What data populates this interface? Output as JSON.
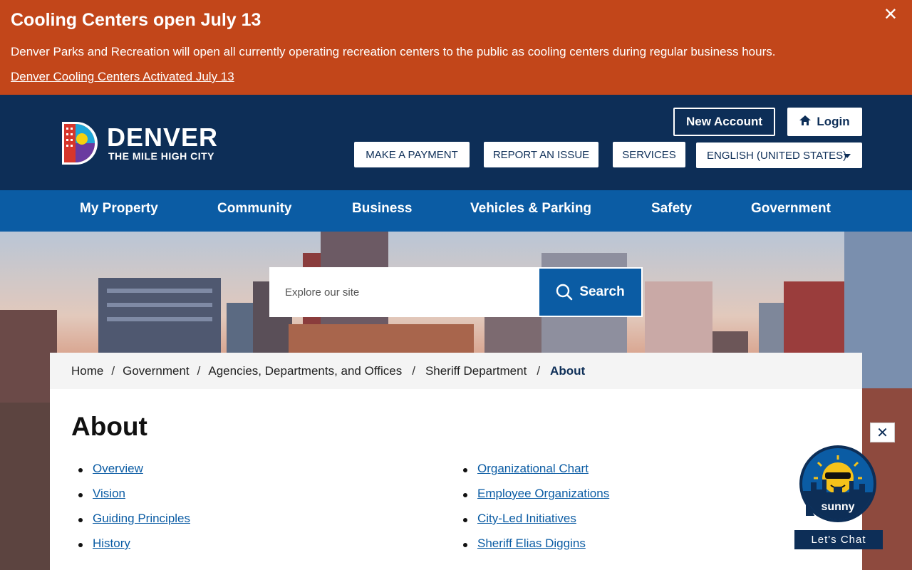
{
  "alert": {
    "title": "Cooling Centers open July 13",
    "message": "Denver Parks and Recreation will open all currently operating recreation centers to the public as cooling centers during regular business hours.",
    "link": "Denver Cooling Centers Activated July 13",
    "close_glyph": "✕"
  },
  "header": {
    "logo_title": "DENVER",
    "logo_subtitle": "THE MILE HIGH CITY",
    "new_account": "New Account",
    "login": "Login",
    "make_payment": "MAKE A PAYMENT",
    "report_issue": "REPORT AN ISSUE",
    "services": "SERVICES",
    "language": "ENGLISH (UNITED STATES)"
  },
  "nav": {
    "items": [
      "My Property",
      "Community",
      "Business",
      "Vehicles & Parking",
      "Safety",
      "Government"
    ]
  },
  "search": {
    "placeholder": "Explore our site",
    "button": "Search"
  },
  "breadcrumb": {
    "items": [
      "Home",
      "Government",
      "Agencies, Departments, and Offices",
      "Sheriff Department"
    ],
    "current": "About",
    "separator": "/"
  },
  "page": {
    "title": "About",
    "left_links": [
      "Overview",
      "Vision",
      "Guiding Principles",
      "History"
    ],
    "right_links": [
      "Organizational Chart",
      "Employee Organizations",
      "City-Led Initiatives",
      "Sheriff Elias Diggins"
    ]
  },
  "chat": {
    "close_glyph": "✕",
    "name": "sunny",
    "label": "Let's Chat"
  },
  "colors": {
    "alert": "#c2461a",
    "header": "#0d2e57",
    "nav": "#0b5ca4"
  }
}
